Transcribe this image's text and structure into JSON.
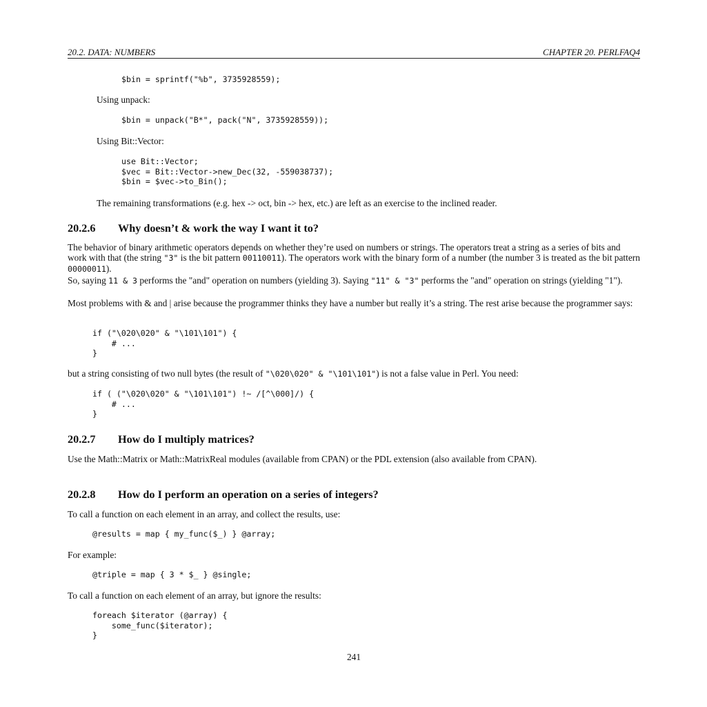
{
  "header": {
    "left": "20.2. DATA: NUMBERS",
    "right": "CHAPTER 20. PERLFAQ4"
  },
  "blocks": {
    "code1": "$bin = sprintf(\"%b\", 3735928559);",
    "using_unpack": "Using unpack:",
    "code2": "$bin = unpack(\"B*\", pack(\"N\", 3735928559));",
    "using_bitvector": "Using Bit::Vector:",
    "code3": "use Bit::Vector;\n$vec = Bit::Vector->new_Dec(32, -559038737);\n$bin = $vec->to_Bin();",
    "remaining": "The remaining transformations (e.g. hex -> oct, bin -> hex, etc.) are left as an exercise to the inclined reader."
  },
  "sec_206": {
    "number": "20.2.6",
    "title": "Why doesn’t & work the way I want it to?",
    "p1_a": "The behavior of binary arithmetic operators depends on whether they’re used on numbers or strings. The operators treat a string as a series of bits and work with that (the string ",
    "p1_code1": "\"3\"",
    "p1_b": " is the bit pattern ",
    "p1_code2": "00110011",
    "p1_c": "). The operators work with the binary form of a number (the number ",
    "p1_num": "3",
    "p1_d": " is treated as the bit pattern ",
    "p1_code3": "00000011",
    "p1_e": ").",
    "p2_a": "So, saying ",
    "p2_code1": "11 & 3",
    "p2_b": " performs the \"and\" operation on numbers (yielding ",
    "p2_num": "3",
    "p2_c": "). Saying ",
    "p2_code2": "\"11\" & \"3\"",
    "p2_d": " performs the \"and\" operation on strings (yielding ",
    "p2_str": "\"1\"",
    "p2_e": ").",
    "p3": "Most problems with & and | arise because the programmer thinks they have a number but really it’s a string. The rest arise because the programmer says:",
    "code4": "if (\"\\020\\020\" & \"\\101\\101\") {\n    # ...\n}",
    "p4_a": "but a string consisting of two null bytes (the result of ",
    "p4_code": "\"\\020\\020\" & \"\\101\\101\"",
    "p4_b": ") is not a false value in Perl. You need:",
    "code5": "if ( (\"\\020\\020\" & \"\\101\\101\") !~ /[^\\000]/) {\n    # ...\n}"
  },
  "sec_207": {
    "number": "20.2.7",
    "title": "How do I multiply matrices?",
    "p1": "Use the Math::Matrix or Math::MatrixReal modules (available from CPAN) or the PDL extension (also available from CPAN)."
  },
  "sec_208": {
    "number": "20.2.8",
    "title": "How do I perform an operation on a series of integers?",
    "p1": "To call a function on each element in an array, and collect the results, use:",
    "code6": "@results = map { my_func($_) } @array;",
    "p2": "For example:",
    "code7": "@triple = map { 3 * $_ } @single;",
    "p3": "To call a function on each element of an array, but ignore the results:",
    "code8": "foreach $iterator (@array) {\n    some_func($iterator);\n}"
  },
  "footer": {
    "page_number": "241"
  }
}
